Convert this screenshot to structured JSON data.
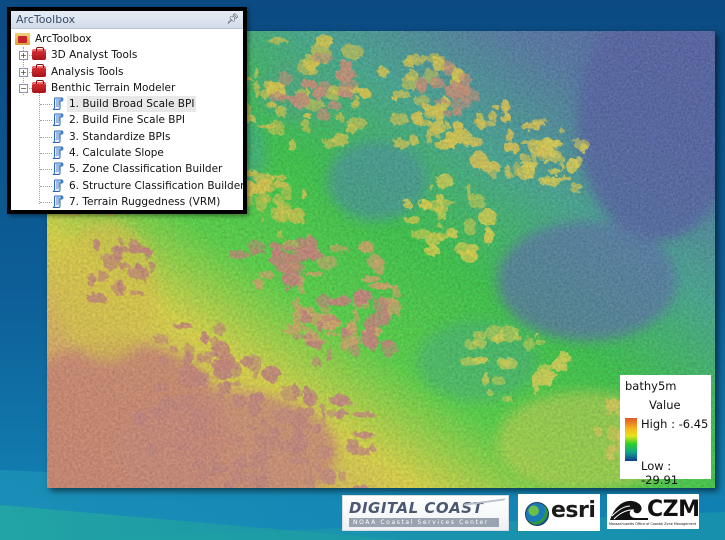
{
  "toolbox": {
    "window_title": "ArcToolbox",
    "pin_icon": "pin-icon",
    "root": {
      "label": "ArcToolbox",
      "icon": "toolbox-folder-icon"
    },
    "toolsets": [
      {
        "label": "3D Analyst Tools",
        "expanded": false,
        "icon": "toolbox-icon"
      },
      {
        "label": "Analysis Tools",
        "expanded": false,
        "icon": "toolbox-icon"
      },
      {
        "label": "Benthic Terrain Modeler",
        "expanded": true,
        "icon": "toolbox-icon"
      }
    ],
    "tools": [
      {
        "label": "1. Build Broad Scale BPI",
        "selected": true,
        "icon": "script-tool-icon"
      },
      {
        "label": "2. Build Fine Scale BPI",
        "icon": "script-tool-icon"
      },
      {
        "label": "3. Standardize BPIs",
        "icon": "script-tool-icon"
      },
      {
        "label": "4. Calculate Slope",
        "icon": "script-tool-icon"
      },
      {
        "label": "5. Zone Classification Builder",
        "icon": "script-tool-icon"
      },
      {
        "label": "6. Structure Classification Builder",
        "icon": "script-tool-icon"
      },
      {
        "label": "7. Terrain Ruggedness (VRM)",
        "icon": "script-tool-icon"
      }
    ],
    "expand_symbol": "+",
    "collapse_symbol": "−"
  },
  "legend": {
    "layer": "bathy5m",
    "field": "Value",
    "high_label": "High : -6.45",
    "low_label": "Low : -29.91",
    "high_value": -6.45,
    "low_value": -29.91,
    "ramp_colors": [
      "#e0552a",
      "#f4b81a",
      "#e6e31a",
      "#2ed12b",
      "#10a58a",
      "#123c8e"
    ]
  },
  "map": {
    "description": "Hillshaded bathymetry raster (bathy5m)",
    "palette": {
      "deep": "#4d5fa3",
      "mid_deep": "#3d9a8a",
      "mid": "#33cc3a",
      "shallow_mid": "#d8d63a",
      "shallow": "#c9826a",
      "peak": "#b06a6a"
    }
  },
  "logos": {
    "digital_coast": {
      "title": "DIGITAL COAST",
      "subtitle": "NOAA Coastal Services Center"
    },
    "esri": {
      "text": "esri"
    },
    "czm": {
      "text": "CZM",
      "subtitle": "Massachusetts Office of Coastal Zone Management"
    }
  },
  "background": {
    "top": "#0b4c86",
    "bottom_left": "#1c8fb4",
    "bottom_teal": "#1fa39a"
  }
}
